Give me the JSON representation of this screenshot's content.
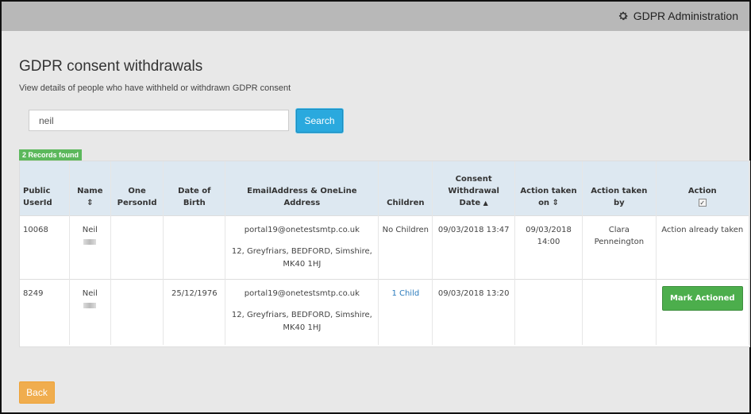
{
  "header": {
    "admin_label": "GDPR Administration",
    "icon": "gear-icon"
  },
  "page": {
    "title": "GDPR consent withdrawals",
    "subtitle": "View details of people who have withheld or withdrawn GDPR consent"
  },
  "search": {
    "value": "neil",
    "button_label": "Search"
  },
  "results": {
    "count_label": "2 Records found"
  },
  "table": {
    "headers": {
      "public_userid": "Public UserId",
      "name": "Name",
      "one_personid": "One PersonId",
      "dob": "Date of Birth",
      "email_address": "EmailAddress & OneLine Address",
      "children": "Children",
      "consent_date": "Consent Withdrawal Date",
      "action_taken_on": "Action taken on",
      "action_taken_by": "Action taken by",
      "action": "Action"
    },
    "sort_icons": {
      "up": "▲",
      "both": "⇕"
    },
    "rows": [
      {
        "public_userid": "10068",
        "name": "Neil",
        "one_personid": "",
        "dob": "",
        "email": "portal19@onetestsmtp.co.uk",
        "address": "12, Greyfriars, BEDFORD, Simshire, MK40 1HJ",
        "children": "No Children",
        "consent_date": "09/03/2018 13:47",
        "action_taken_on": "09/03/2018 14:00",
        "action_taken_by": "Clara Penneington",
        "action": "Action already taken"
      },
      {
        "public_userid": "8249",
        "name": "Neil",
        "one_personid": "",
        "dob": "25/12/1976",
        "email": "portal19@onetestsmtp.co.uk",
        "address": "12, Greyfriars, BEDFORD, Simshire, MK40 1HJ",
        "children": "1 Child",
        "consent_date": "09/03/2018 13:20",
        "action_taken_on": "",
        "action_taken_by": "",
        "action_button": "Mark Actioned"
      }
    ]
  },
  "footer": {
    "back_label": "Back"
  },
  "colors": {
    "search_button": "#2aa9de",
    "badge": "#5cb85c",
    "mark_button": "#4cae4c",
    "back_button": "#f0ad4e",
    "table_header": "#dde8f1"
  }
}
